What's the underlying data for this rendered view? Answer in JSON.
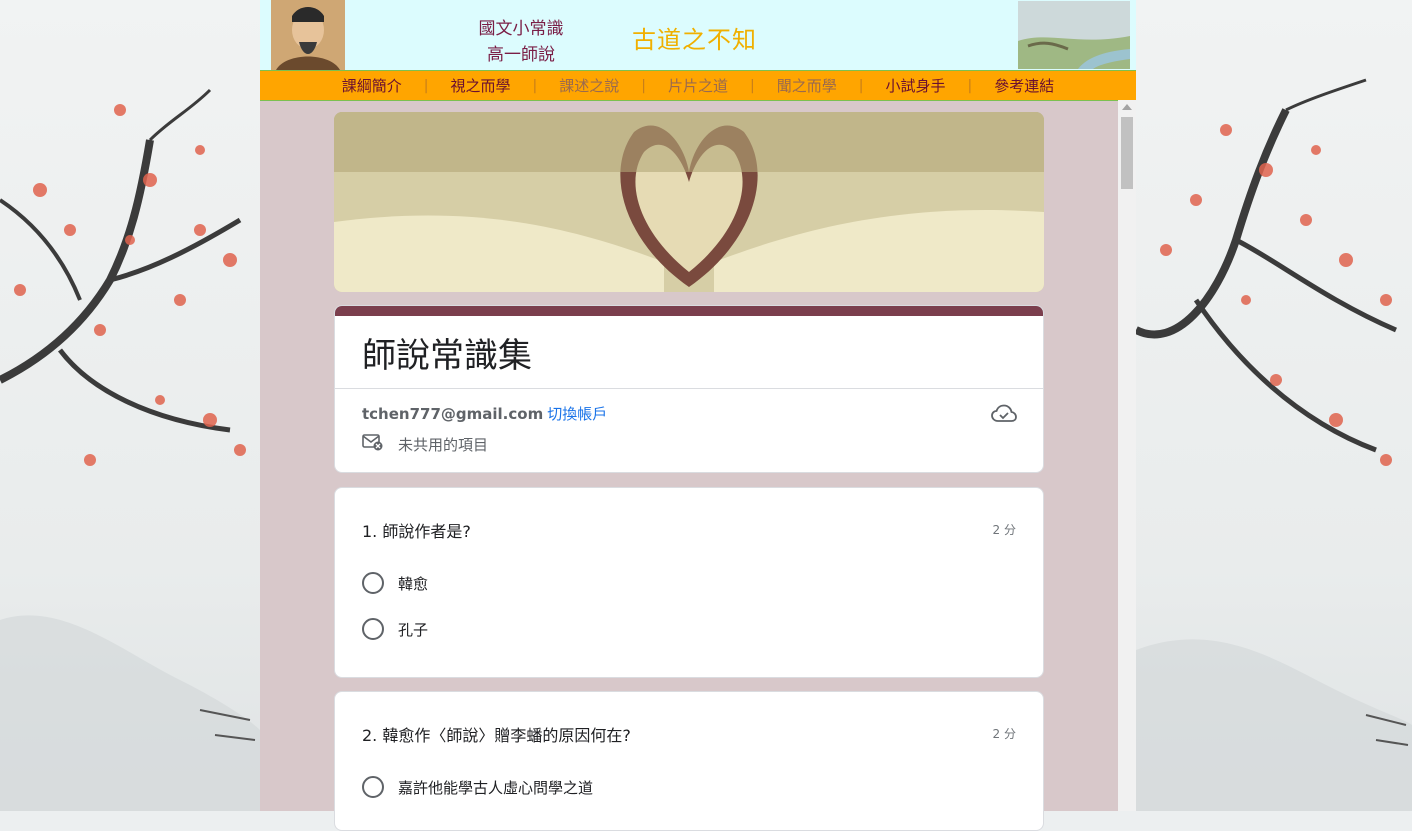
{
  "header": {
    "site_subtitle_line1": "國文小常識",
    "site_subtitle_line2": "高一師說",
    "site_title": "古道之不知"
  },
  "nav": {
    "items": [
      {
        "label": "課綱簡介",
        "active": true
      },
      {
        "label": "視之而學",
        "active": true
      },
      {
        "label": "課述之說",
        "active": false
      },
      {
        "label": "片片之道",
        "active": false
      },
      {
        "label": "聞之而學",
        "active": false
      },
      {
        "label": "小試身手",
        "active": true
      },
      {
        "label": "參考連結",
        "active": true
      }
    ],
    "separator": "|"
  },
  "form": {
    "title": "師說常識集",
    "account_email": "tchen777@gmail.com",
    "switch_account": "切換帳戶",
    "not_shared": "未共用的項目",
    "accent_color": "#7b3e4d",
    "questions": [
      {
        "text": "1. 師說作者是?",
        "points": "2 分",
        "options": [
          "韓愈",
          "孔子"
        ]
      },
      {
        "text": "2. 韓愈作〈師說〉贈李蟠的原因何在?",
        "points": "2 分",
        "options": [
          "嘉許他能學古人虛心問學之道"
        ]
      }
    ]
  },
  "colors": {
    "nav_bg": "#ffa500",
    "header_bg": "#dcfcfe",
    "page_bg": "#d8c8ca"
  }
}
